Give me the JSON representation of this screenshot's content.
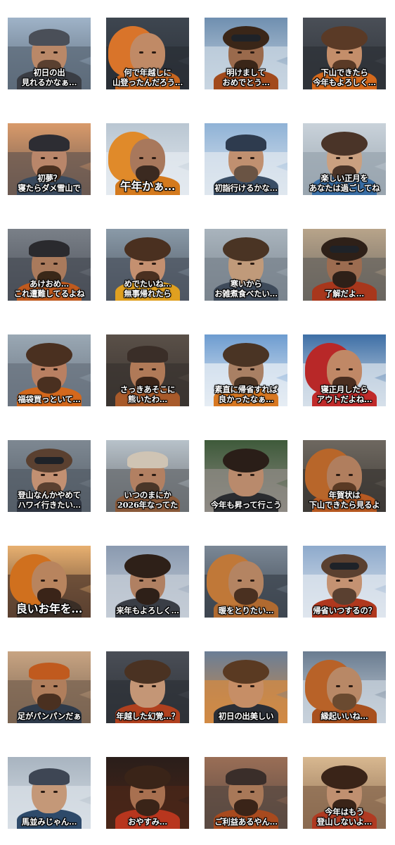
{
  "stickers": [
    {
      "caption": "初日の出\n見れるかなぁ…",
      "palette": {
        "sky": "#9fb3c8",
        "mtn": "#5d6b7a",
        "skin": "#b98868",
        "outer": "#3a3d44",
        "gear": "#4a4f58",
        "beard": "#5a4030"
      },
      "gear": "hat",
      "beard": true
    },
    {
      "caption": "何で年越しに\n山登ったんだろう…",
      "palette": {
        "sky": "#3e4650",
        "mtn": "#2a2f36",
        "skin": "#c08a66",
        "outer": "#c8661f",
        "gear": "#d9742a",
        "beard": "#6b4128"
      },
      "gear": "hood",
      "beard": false
    },
    {
      "caption": "明けまして\nおめでとう…",
      "palette": {
        "sky": "#6f8fb0",
        "mtn": "#c9d6e2",
        "skin": "#9a6a4c",
        "outer": "#a24a1c",
        "gear": "#3c2c22",
        "beard": "#3a2618"
      },
      "gear": "goggles",
      "beard": true
    },
    {
      "caption": "下山できたら\n今年もよろしく…",
      "palette": {
        "sky": "#4a4f57",
        "mtn": "#2e3238",
        "skin": "#c48e6a",
        "outer": "#d4691c",
        "gear": "#5a3a26",
        "beard": "#5a3a26"
      },
      "gear": "hair",
      "beard": true
    },
    {
      "caption": "初夢？\n寝たらダメ雪山で",
      "palette": {
        "sky": "#d99a6a",
        "mtn": "#6b5a52",
        "skin": "#b9866a",
        "outer": "#3a4a5e",
        "gear": "#2d2d33",
        "beard": "#4a3020"
      },
      "gear": "hat",
      "beard": true
    },
    {
      "caption": "午年かぁ…",
      "palette": {
        "sky": "#b9c6d2",
        "mtn": "#e4eaf0",
        "skin": "#a8785c",
        "outer": "#d47a1e",
        "gear": "#e08a2a",
        "beard": "#3b2a20"
      },
      "gear": "hood",
      "beard": true,
      "big": true
    },
    {
      "caption": "初詣行けるかな…",
      "palette": {
        "sky": "#8fb2d6",
        "mtn": "#dfe7ef",
        "skin": "#c09070",
        "outer": "#3a4e66",
        "gear": "#2e3b4e",
        "beard": "#6a5444"
      },
      "gear": "hat",
      "beard": true
    },
    {
      "caption": "楽しい正月を\nあなたは過ごしてね",
      "palette": {
        "sky": "#c9d2da",
        "mtn": "#9aa6b0",
        "skin": "#caa080",
        "outer": "#3a6fa6",
        "gear": "#3a2a22",
        "beard": "#4a3428"
      },
      "gear": "hair",
      "beard": true
    },
    {
      "caption": "あけおめ…\nこれ遭難してるよね",
      "palette": {
        "sky": "#7a8088",
        "mtn": "#4a4f58",
        "skin": "#a97a5c",
        "outer": "#c05a1e",
        "gear": "#2a2a2e",
        "beard": "#3a2818"
      },
      "gear": "hat",
      "beard": true
    },
    {
      "caption": "めでたいね…\n無事帰れたら",
      "palette": {
        "sky": "#8a9aa8",
        "mtn": "#4e5662",
        "skin": "#c49070",
        "outer": "#e0a020",
        "gear": "#5a3a22",
        "beard": "#4a3020"
      },
      "gear": "hair",
      "beard": true
    },
    {
      "caption": "寒いから\nお雑煮食べたい…",
      "palette": {
        "sky": "#a9b4bd",
        "mtn": "#7b858f",
        "skin": "#c09a7a",
        "outer": "#3e4a5a",
        "gear": "#5a4230",
        "beard": "#4a3424"
      },
      "gear": "hair",
      "beard": false
    },
    {
      "caption": "了解だよ…",
      "palette": {
        "sky": "#b8a48a",
        "mtn": "#6a6660",
        "skin": "#9c6c50",
        "outer": "#a8371c",
        "gear": "#2a3a4a",
        "beard": "#2e2018"
      },
      "gear": "goggles",
      "beard": true
    },
    {
      "caption": "福袋買っといて…",
      "palette": {
        "sky": "#9aa8b4",
        "mtn": "#6a7480",
        "skin": "#b98062",
        "outer": "#d4681c",
        "gear": "#3a2a20",
        "beard": "#4a3020"
      },
      "gear": "hair",
      "beard": true
    },
    {
      "caption": "さっきあそこに\n熊いたわ…",
      "palette": {
        "sky": "#5a5048",
        "mtn": "#3a3430",
        "skin": "#b07a58",
        "outer": "#a85a2a",
        "gear": "#3a2e28",
        "beard": "#3a2418"
      },
      "gear": "hat",
      "beard": true
    },
    {
      "caption": "素直に帰省すれば\n良かったなぁ…",
      "palette": {
        "sky": "#6d9cd0",
        "mtn": "#e6edf4",
        "skin": "#a98064",
        "outer": "#d87822",
        "gear": "#4a3526",
        "beard": "#4a3424"
      },
      "gear": "hair",
      "beard": true
    },
    {
      "caption": "寝正月したら\nアウトだよね…",
      "palette": {
        "sky": "#3e6fa6",
        "mtn": "#d6e0ea",
        "skin": "#c08866",
        "outer": "#c02a2a",
        "gear": "#b82828",
        "beard": "#4a2e20"
      },
      "gear": "hood",
      "beard": true
    },
    {
      "caption": "登山なんかやめて\nハワイ行きたい…",
      "palette": {
        "sky": "#7e8892",
        "mtn": "#555e68",
        "skin": "#c29072",
        "outer": "#2e3440",
        "gear": "#3a3e46",
        "beard": "#5a4030"
      },
      "gear": "goggles",
      "beard": true
    },
    {
      "caption": "いつのまにか\n2026年なってた",
      "palette": {
        "sky": "#b8c2ca",
        "mtn": "#6a6e72",
        "skin": "#b28062",
        "outer": "#8a5a3a",
        "gear": "#cfc4b4",
        "beard": "#4a3628"
      },
      "gear": "hat",
      "beard": true
    },
    {
      "caption": "今年も昇って行こう",
      "palette": {
        "sky": "#3e5a3a",
        "mtn": "#8e8a84",
        "skin": "#b98a6c",
        "outer": "#2a2c30",
        "gear": "#1e1e22",
        "beard": "#2a1e18"
      },
      "gear": "hair",
      "beard": false
    },
    {
      "caption": "年賀状は\n下山できたら見るよ",
      "palette": {
        "sky": "#6e6860",
        "mtn": "#3e3a36",
        "skin": "#b07e5e",
        "outer": "#b85a22",
        "gear": "#b8662a",
        "beard": "#5a3a24"
      },
      "gear": "hood",
      "beard": true
    },
    {
      "caption": "良いお年を…",
      "palette": {
        "sky": "#e8b070",
        "mtn": "#5a4030",
        "skin": "#b8845e",
        "outer": "#3a2e26",
        "gear": "#d0701e",
        "beard": "#3a2418"
      },
      "gear": "hood",
      "beard": true,
      "big": true
    },
    {
      "caption": "来年もよろしく…",
      "palette": {
        "sky": "#8a9ab0",
        "mtn": "#c4ccd6",
        "skin": "#b08062",
        "outer": "#3a3e46",
        "gear": "#2a2a30",
        "beard": "#2e2018"
      },
      "gear": "hair",
      "beard": true
    },
    {
      "caption": "暖をとりたい…",
      "palette": {
        "sky": "#7b8896",
        "mtn": "#3e4650",
        "skin": "#b48462",
        "outer": "#b06a30",
        "gear": "#c07838",
        "beard": "#4a3020"
      },
      "gear": "hood",
      "beard": true
    },
    {
      "caption": "帰省いつするの？",
      "palette": {
        "sky": "#8eaacc",
        "mtn": "#dfe6ee",
        "skin": "#c49272",
        "outer": "#b0381e",
        "gear": "#2a2e36",
        "beard": "#5a4030"
      },
      "gear": "goggles",
      "beard": true
    },
    {
      "caption": "足がパンパンだぁ",
      "palette": {
        "sky": "#c8a482",
        "mtn": "#7a6452",
        "skin": "#b07e5c",
        "outer": "#2e3a4a",
        "gear": "#c05a1e",
        "beard": "#4a3020"
      },
      "gear": "hat",
      "beard": true
    },
    {
      "caption": "年越した幻覚…？",
      "palette": {
        "sky": "#4a4e56",
        "mtn": "#2e3238",
        "skin": "#c49676",
        "outer": "#b0401e",
        "gear": "#3a2a22",
        "beard": "#4a3222"
      },
      "gear": "hair",
      "beard": false
    },
    {
      "caption": "初日の出美しい",
      "palette": {
        "sky": "#6a7e96",
        "mtn": "#d28a44",
        "skin": "#c68e66",
        "outer": "#2a2e36",
        "gear": "#8a5a34",
        "beard": "#5a3a22"
      },
      "gear": "hair",
      "beard": false
    },
    {
      "caption": "縁起いいね…",
      "palette": {
        "sky": "#6a7c90",
        "mtn": "#c8d2dc",
        "skin": "#b88866",
        "outer": "#a8501e",
        "gear": "#b86228",
        "beard": "#6a4a30"
      },
      "gear": "hood",
      "beard": true
    },
    {
      "caption": "馬並みじゃん…",
      "palette": {
        "sky": "#a8b4c0",
        "mtn": "#d8dfe6",
        "skin": "#c49878",
        "outer": "#2e4a6a",
        "gear": "#3e4654",
        "beard": "#7a5a40"
      },
      "gear": "hat",
      "beard": false
    },
    {
      "caption": "おやすみ…",
      "palette": {
        "sky": "#2a1e1a",
        "mtn": "#4a2618",
        "skin": "#a87050",
        "outer": "#b8361e",
        "gear": "#3a2620",
        "beard": "#3a2418"
      },
      "gear": "hair",
      "beard": true
    },
    {
      "caption": "ご利益あるやん…",
      "palette": {
        "sky": "#9a6e56",
        "mtn": "#5a4a42",
        "skin": "#a87858",
        "outer": "#a84a1e",
        "gear": "#3a2e2a",
        "beard": "#3a2418"
      },
      "gear": "hat",
      "beard": true
    },
    {
      "caption": "今年はもう\n登山しないよ…",
      "palette": {
        "sky": "#d8b890",
        "mtn": "#8a6a50",
        "skin": "#c09070",
        "outer": "#b03a22",
        "gear": "#3a2a22",
        "beard": "#3a2418"
      },
      "gear": "hair",
      "beard": true
    }
  ]
}
